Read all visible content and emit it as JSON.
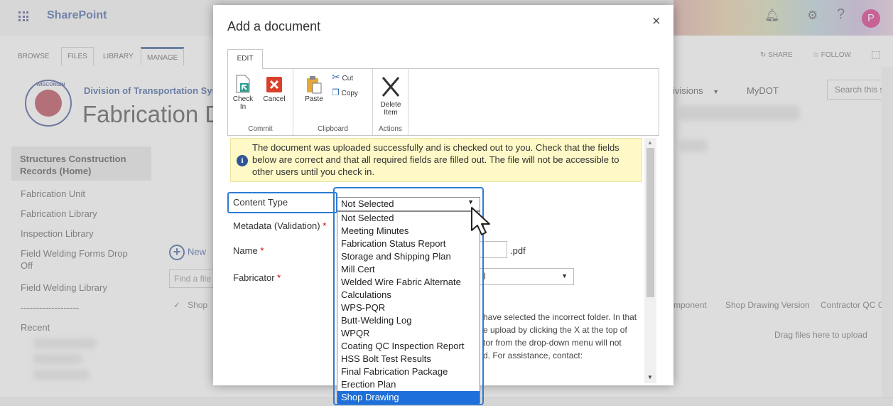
{
  "suitebar": {
    "brand": "SharePoint",
    "avatar_initial": "P",
    "icons": [
      "waffle-icon",
      "bell-icon",
      "gear-icon",
      "help-icon"
    ]
  },
  "ribbon_tabs": [
    "BROWSE",
    "FILES",
    "LIBRARY",
    "MANAGE"
  ],
  "page_actions": {
    "share": "SHARE",
    "follow": "FOLLOW"
  },
  "site": {
    "subtitle": "Division of Transportation Syst",
    "title": "Fabrication D",
    "logo_text": "WISCONSIN"
  },
  "top_nav": {
    "divisions": "ivisions",
    "mydot": "MyDOT",
    "search_placeholder": "Search this si"
  },
  "left_nav": {
    "home": "Structures Construction Records (Home)",
    "items": [
      "Fabrication Unit",
      "Fabrication Library",
      "Inspection Library",
      "Field Welding Forms Drop Off",
      "Field Welding Library",
      "-------------------",
      "Recent"
    ]
  },
  "library": {
    "new_label": "New",
    "find_placeholder": "Find a file",
    "columns": [
      "Shop",
      "mponent",
      "Shop Drawing Version",
      "Contractor QC Co"
    ],
    "drop_hint": "Drag files here to upload"
  },
  "dialog": {
    "title": "Add a document",
    "close": "×",
    "edit_tab": "EDIT",
    "groups": [
      {
        "label": "Commit",
        "buttons": [
          "Check In",
          "Cancel"
        ]
      },
      {
        "label": "Clipboard",
        "buttons": [
          "Paste",
          "Cut",
          "Copy"
        ]
      },
      {
        "label": "Actions",
        "buttons": [
          "Delete Item"
        ]
      }
    ],
    "info_message": "The document was uploaded successfully and is checked out to you. Check that the fields below are correct and that all required fields are filled out. The file will not be accessible to other users until you check in.",
    "fields": {
      "content_type": "Content Type",
      "metadata": "Metadata (Validation)",
      "name": "Name",
      "name_ext": ".pdf",
      "fabricator": "Fabricator",
      "fabricator_partial": "l"
    },
    "help_lines": [
      "have selected the incorrect folder. In that",
      "e upload by clicking the X at the top of",
      "tor from the drop-down menu will not",
      "d. For assistance, contact:"
    ],
    "content_type_select": {
      "value": "Not Selected",
      "options": [
        "Not Selected",
        "Meeting Minutes",
        "Fabrication Status Report",
        "Storage and Shipping Plan",
        "Mill Cert",
        "Welded Wire Fabric Alternate",
        "Calculations",
        "WPS-PQR",
        "Butt-Welding Log",
        "WPQR",
        "Coating QC Inspection Report",
        "HSS Bolt Test Results",
        "Final Fabrication Package",
        "Erection Plan",
        "Shop Drawing"
      ],
      "highlighted": "Shop Drawing"
    }
  },
  "colors": {
    "accent": "#2e7bd3",
    "selection": "#1e6fd9",
    "brand": "#3a5ba0",
    "info_bg": "#fff9c7"
  }
}
